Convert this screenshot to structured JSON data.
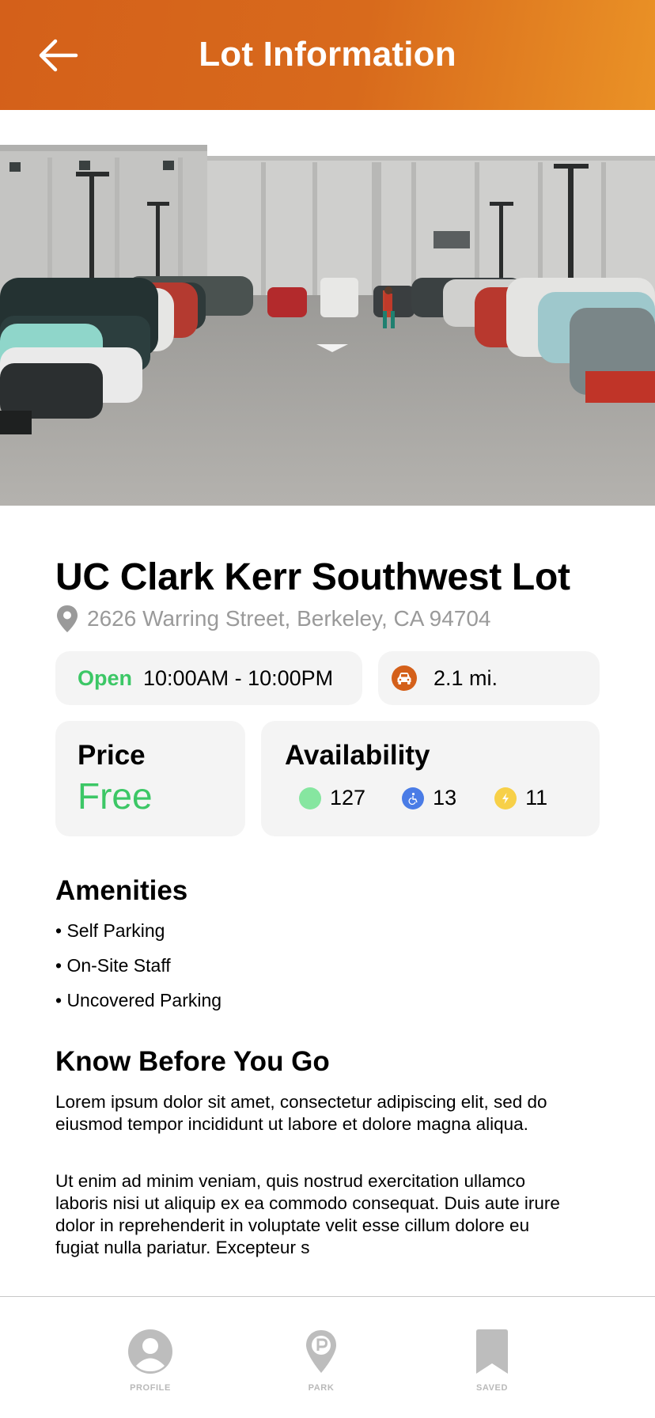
{
  "header": {
    "title": "Lot Information",
    "back_icon": "arrow-left-icon"
  },
  "photo": {
    "subject": "parking-lot-photo"
  },
  "lot": {
    "name": "UC Clark Kerr Southwest Lot",
    "address": "2626 Warring Street, Berkeley, CA 94704"
  },
  "hours": {
    "status": "Open",
    "range": "10:00AM - 10:00PM"
  },
  "distance": {
    "value": "2.1 mi."
  },
  "price": {
    "title": "Price",
    "value": "Free"
  },
  "availability": {
    "title": "Availability",
    "standard": "127",
    "accessible": "13",
    "ev": "11",
    "colors": {
      "standard": "#86e6a0",
      "accessible": "#4a7ce6",
      "ev": "#f7d048"
    }
  },
  "amenities": {
    "title": "Amenities",
    "items": [
      "• Self Parking",
      "• On-Site Staff",
      "• Uncovered Parking"
    ]
  },
  "know": {
    "title": "Know Before You Go",
    "p1": "Lorem ipsum dolor sit amet, consectetur adipiscing elit, sed do eiusmod tempor incididunt ut labore et dolore magna aliqua.",
    "p2": "Ut enim ad minim veniam, quis nostrud exercitation ullamco laboris nisi ut aliquip ex ea commodo consequat. Duis aute irure dolor in reprehenderit in voluptate velit esse cillum dolore eu fugiat nulla pariatur. Excepteur s"
  },
  "tabs": [
    {
      "label": "PROFILE",
      "icon": "profile-icon"
    },
    {
      "label": "PARK",
      "icon": "park-pin-icon"
    },
    {
      "label": "SAVED",
      "icon": "bookmark-icon"
    }
  ],
  "colors": {
    "brand": "#d4601a",
    "brand_light": "#ea9226",
    "open_green": "#3cc766",
    "card_bg": "#f4f4f4"
  }
}
